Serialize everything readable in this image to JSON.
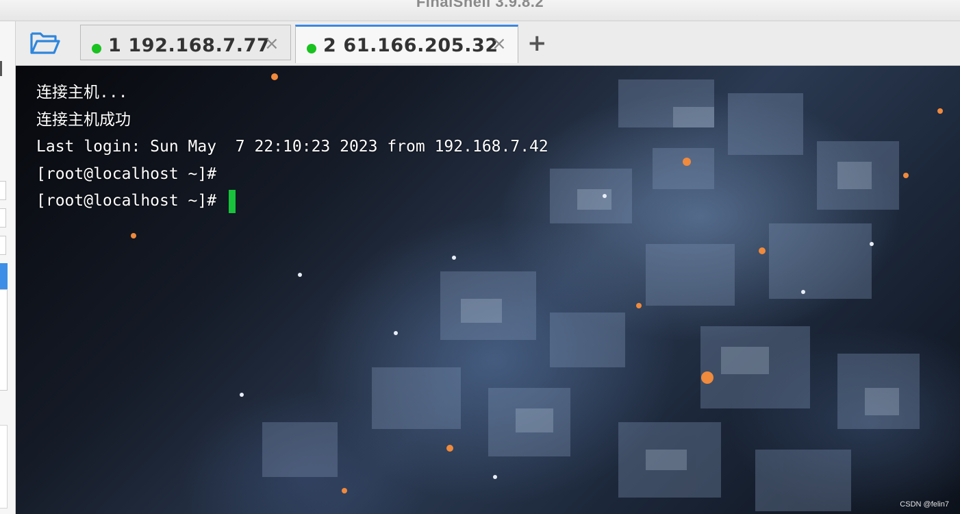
{
  "window": {
    "title": "FinalShell 3.9.8.2"
  },
  "toolbar": {
    "folder_icon": "folder-open-icon",
    "add_tab_label": "+"
  },
  "tabs": [
    {
      "label": "1 192.168.7.77",
      "close": "×",
      "active": false,
      "status_color": "#19c21f"
    },
    {
      "label": "2 61.166.205.32",
      "close": "×",
      "active": true,
      "status_color": "#19c21f"
    }
  ],
  "terminal": {
    "lines": [
      "连接主机...",
      "连接主机成功",
      "Last login: Sun May  7 22:10:23 2023 from 192.168.7.42",
      "[root@localhost ~]#",
      "[root@localhost ~]# "
    ],
    "cursor_color": "#19c23b"
  },
  "watermark": "CSDN @felin7",
  "colors": {
    "accent": "#3a87e0",
    "status_online": "#19c21f"
  }
}
